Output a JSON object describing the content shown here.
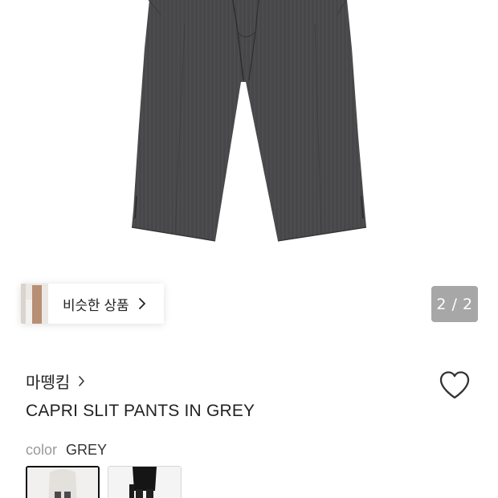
{
  "gallery": {
    "similar_label": "비슷한 상품",
    "page_indicator": "2 / 2"
  },
  "product": {
    "brand": "마뗑킴",
    "title": "CAPRI SLIT PANTS IN GREY",
    "color_label": "color",
    "color_value": "GREY"
  },
  "icons": {
    "similar_chevron": "chevron-right-icon",
    "brand_chevron": "chevron-right-icon",
    "wishlist": "heart-outline-icon"
  },
  "colors": {
    "pants": "#4a4a4c",
    "indicator_bg": "#a7a7a7",
    "selected_border": "#111111"
  }
}
